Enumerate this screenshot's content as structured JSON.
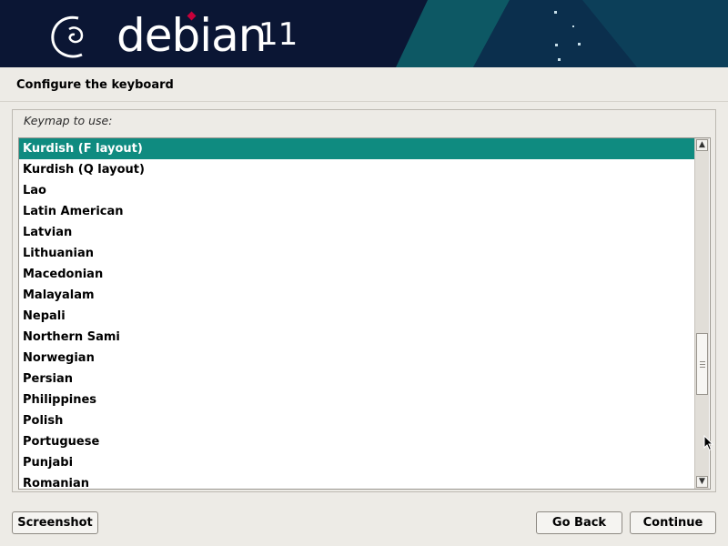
{
  "colors": {
    "banner_bg": "#0b1634",
    "banner_accent": "#0f6f74",
    "selection": "#0f8b80",
    "brand_dot": "#c8003a"
  },
  "banner": {
    "brand": "debian",
    "version": "11",
    "logo_icon": "debian-swirl-icon"
  },
  "page": {
    "title": "Configure the keyboard"
  },
  "keymap": {
    "label": "Keymap to use:",
    "selected_index": 0,
    "items": [
      "Kurdish (F layout)",
      "Kurdish (Q layout)",
      "Lao",
      "Latin American",
      "Latvian",
      "Lithuanian",
      "Macedonian",
      "Malayalam",
      "Nepali",
      "Northern Sami",
      "Norwegian",
      "Persian",
      "Philippines",
      "Polish",
      "Portuguese",
      "Punjabi",
      "Romanian"
    ]
  },
  "buttons": {
    "screenshot": "Screenshot",
    "go_back": "Go Back",
    "continue": "Continue"
  }
}
